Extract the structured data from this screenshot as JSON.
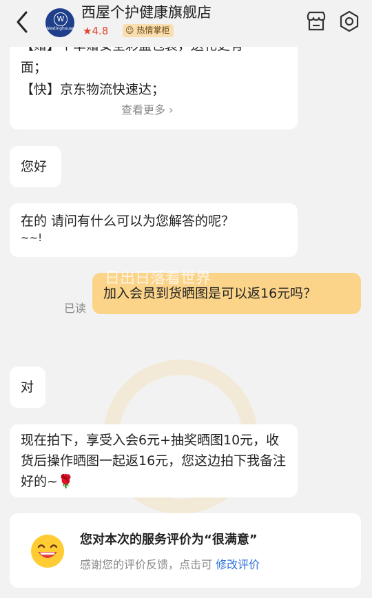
{
  "header": {
    "shop_name": "西屋个护健康旗舰店",
    "rating": "4.8",
    "badge": "热情掌柜",
    "logo_text": "Westinghouse"
  },
  "messages": {
    "m1_line1": "【赠】个单赠安全彩盒包装，送礼更有",
    "m1_line2": "面；",
    "m1_line3": "【快】京东物流快速达；",
    "m1_more": "查看更多",
    "m2": "您好",
    "m3": "在的  请问有什么可以为您解答的呢？",
    "m3_tail": "~~!",
    "sent": "加入会员到货晒图是可以返16元吗？",
    "read_status": "已读",
    "m4": "对",
    "m5": "现在拍下，享受入会6元+抽奖晒图10元，收货后操作晒图一起返16元，您这边拍下我备注好的~🌹"
  },
  "watermark": "日出日落看世界",
  "evaluation": {
    "title": "您对本次的服务评价为“很满意”",
    "subtitle": "感谢您的评价反馈，点击可",
    "link": "修改评价"
  },
  "icons": [
    "back-icon",
    "star-icon",
    "store-icon",
    "settings-icon",
    "smile-icon"
  ],
  "colors": {
    "sent_bubble": "#fbd489",
    "link": "#2a6fdb",
    "rating": "#e4432d"
  }
}
